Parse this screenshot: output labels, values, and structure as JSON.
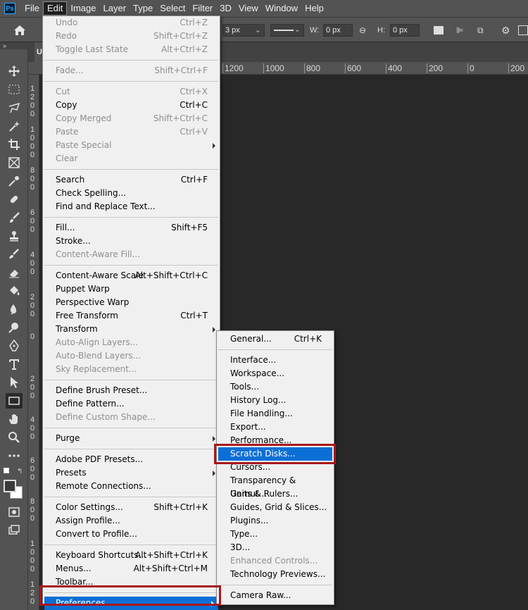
{
  "app": {
    "logo": "Ps"
  },
  "menubar": [
    "File",
    "Edit",
    "Image",
    "Layer",
    "Type",
    "Select",
    "Filter",
    "3D",
    "View",
    "Window",
    "Help"
  ],
  "options_bar": {
    "stroke_size": "3 px",
    "w_label": "W:",
    "w_value": "0 px",
    "h_label": "H:",
    "h_value": "0 px"
  },
  "tab": {
    "label": "U"
  },
  "hruler": [
    "1200",
    "1000",
    "800",
    "600",
    "400",
    "200",
    "0",
    "200"
  ],
  "vruler": [
    "1\n2\n0\n0",
    "1\n0\n0\n0",
    "8\n0\n0",
    "6\n0\n0",
    "4\n0\n0",
    "2\n0\n0",
    "0",
    "2\n0\n0",
    "4\n0\n0",
    "6\n0\n0",
    "8\n0\n0",
    "1\n0\n0\n0",
    "1\n2\n0"
  ],
  "edit_menu": [
    {
      "label": "Undo",
      "shortcut": "Ctrl+Z",
      "disabled": true
    },
    {
      "label": "Redo",
      "shortcut": "Shift+Ctrl+Z",
      "disabled": true
    },
    {
      "label": "Toggle Last State",
      "shortcut": "Alt+Ctrl+Z",
      "disabled": true
    },
    {
      "sep": true
    },
    {
      "label": "Fade...",
      "shortcut": "Shift+Ctrl+F",
      "disabled": true
    },
    {
      "sep": true
    },
    {
      "label": "Cut",
      "shortcut": "Ctrl+X",
      "disabled": true
    },
    {
      "label": "Copy",
      "shortcut": "Ctrl+C",
      "disabled": false
    },
    {
      "label": "Copy Merged",
      "shortcut": "Shift+Ctrl+C",
      "disabled": true
    },
    {
      "label": "Paste",
      "shortcut": "Ctrl+V",
      "disabled": true
    },
    {
      "label": "Paste Special",
      "shortcut": "",
      "disabled": true,
      "submenu": true
    },
    {
      "label": "Clear",
      "shortcut": "",
      "disabled": true
    },
    {
      "sep": true
    },
    {
      "label": "Search",
      "shortcut": "Ctrl+F",
      "disabled": false
    },
    {
      "label": "Check Spelling...",
      "shortcut": "",
      "disabled": false
    },
    {
      "label": "Find and Replace Text...",
      "shortcut": "",
      "disabled": false
    },
    {
      "sep": true
    },
    {
      "label": "Fill...",
      "shortcut": "Shift+F5",
      "disabled": false
    },
    {
      "label": "Stroke...",
      "shortcut": "",
      "disabled": false
    },
    {
      "label": "Content-Aware Fill...",
      "shortcut": "",
      "disabled": true
    },
    {
      "sep": true
    },
    {
      "label": "Content-Aware Scale",
      "shortcut": "Alt+Shift+Ctrl+C",
      "disabled": false
    },
    {
      "label": "Puppet Warp",
      "shortcut": "",
      "disabled": false
    },
    {
      "label": "Perspective Warp",
      "shortcut": "",
      "disabled": false
    },
    {
      "label": "Free Transform",
      "shortcut": "Ctrl+T",
      "disabled": false
    },
    {
      "label": "Transform",
      "shortcut": "",
      "disabled": false,
      "submenu": true
    },
    {
      "label": "Auto-Align Layers...",
      "shortcut": "",
      "disabled": true
    },
    {
      "label": "Auto-Blend Layers...",
      "shortcut": "",
      "disabled": true
    },
    {
      "label": "Sky Replacement...",
      "shortcut": "",
      "disabled": true
    },
    {
      "sep": true
    },
    {
      "label": "Define Brush Preset...",
      "shortcut": "",
      "disabled": false
    },
    {
      "label": "Define Pattern...",
      "shortcut": "",
      "disabled": false
    },
    {
      "label": "Define Custom Shape...",
      "shortcut": "",
      "disabled": true
    },
    {
      "sep": true
    },
    {
      "label": "Purge",
      "shortcut": "",
      "disabled": false,
      "submenu": true
    },
    {
      "sep": true
    },
    {
      "label": "Adobe PDF Presets...",
      "shortcut": "",
      "disabled": false
    },
    {
      "label": "Presets",
      "shortcut": "",
      "disabled": false,
      "submenu": true
    },
    {
      "label": "Remote Connections...",
      "shortcut": "",
      "disabled": false
    },
    {
      "sep": true
    },
    {
      "label": "Color Settings...",
      "shortcut": "Shift+Ctrl+K",
      "disabled": false
    },
    {
      "label": "Assign Profile...",
      "shortcut": "",
      "disabled": false
    },
    {
      "label": "Convert to Profile...",
      "shortcut": "",
      "disabled": false
    },
    {
      "sep": true
    },
    {
      "label": "Keyboard Shortcuts...",
      "shortcut": "Alt+Shift+Ctrl+K",
      "disabled": false
    },
    {
      "label": "Menus...",
      "shortcut": "Alt+Shift+Ctrl+M",
      "disabled": false
    },
    {
      "label": "Toolbar...",
      "shortcut": "",
      "disabled": false
    },
    {
      "sep": true
    },
    {
      "label": "Preferences",
      "shortcut": "",
      "disabled": false,
      "submenu": true,
      "highlighted": true
    }
  ],
  "prefs_menu": [
    {
      "label": "General...",
      "shortcut": "Ctrl+K",
      "disabled": false
    },
    {
      "sep": true
    },
    {
      "label": "Interface...",
      "shortcut": "",
      "disabled": false
    },
    {
      "label": "Workspace...",
      "shortcut": "",
      "disabled": false
    },
    {
      "label": "Tools...",
      "shortcut": "",
      "disabled": false
    },
    {
      "label": "History Log...",
      "shortcut": "",
      "disabled": false
    },
    {
      "label": "File Handling...",
      "shortcut": "",
      "disabled": false
    },
    {
      "label": "Export...",
      "shortcut": "",
      "disabled": false
    },
    {
      "label": "Performance...",
      "shortcut": "",
      "disabled": false
    },
    {
      "label": "Scratch Disks...",
      "shortcut": "",
      "disabled": false,
      "highlighted": true
    },
    {
      "label": "Cursors...",
      "shortcut": "",
      "disabled": false
    },
    {
      "label": "Transparency & Gamut...",
      "shortcut": "",
      "disabled": false
    },
    {
      "label": "Units & Rulers...",
      "shortcut": "",
      "disabled": false
    },
    {
      "label": "Guides, Grid & Slices...",
      "shortcut": "",
      "disabled": false
    },
    {
      "label": "Plugins...",
      "shortcut": "",
      "disabled": false
    },
    {
      "label": "Type...",
      "shortcut": "",
      "disabled": false
    },
    {
      "label": "3D...",
      "shortcut": "",
      "disabled": false
    },
    {
      "label": "Enhanced Controls...",
      "shortcut": "",
      "disabled": true
    },
    {
      "label": "Technology Previews...",
      "shortcut": "",
      "disabled": false
    },
    {
      "sep": true
    },
    {
      "label": "Camera Raw...",
      "shortcut": "",
      "disabled": false
    }
  ],
  "colors": {
    "highlight": "#0c6fd6",
    "annotation": "#a8181c",
    "menu_bg": "#f0f0f0",
    "ui_bg": "#535353"
  },
  "tools": [
    "move-icon",
    "marquee-icon",
    "lasso-icon",
    "magic-wand-icon",
    "crop-icon",
    "frame-icon",
    "eyedropper-icon",
    "healing-brush-icon",
    "brush-icon",
    "clone-stamp-icon",
    "history-brush-icon",
    "eraser-icon",
    "paint-bucket-icon",
    "blur-icon",
    "dodge-icon",
    "pen-icon",
    "type-icon",
    "path-selection-icon",
    "rectangle-icon",
    "hand-icon",
    "zoom-icon",
    "more-tools-icon"
  ]
}
